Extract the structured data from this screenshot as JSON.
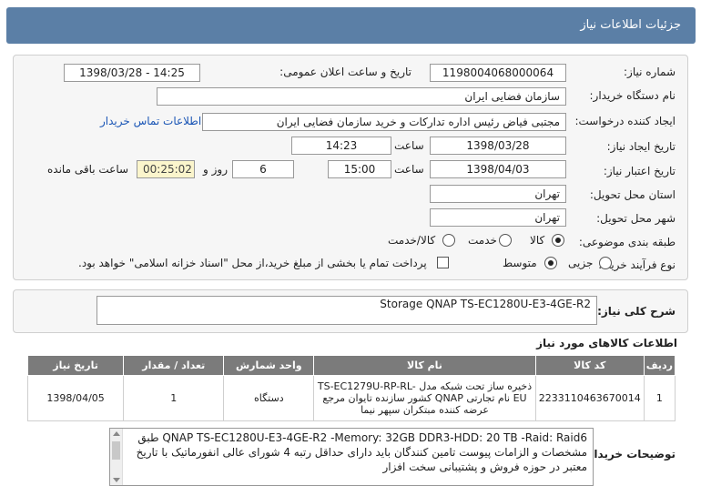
{
  "header": {
    "title": "جزئیات اطلاعات نیاز"
  },
  "form": {
    "need_number_label": "شماره نیاز:",
    "need_number": "1198004068000064",
    "announce_label": "تاریخ و ساعت اعلان عمومی:",
    "announce_value": "1398/03/28 - 14:25",
    "buyer_org_label": "نام دستگاه خریدار:",
    "buyer_org": "سازمان فضایی ایران",
    "creator_label": "ایجاد کننده درخواست:",
    "creator": "مجتبی  فیاض رئیس اداره تدارکات و خرید سازمان فضایی ایران",
    "contact_link": "اطلاعات تماس خریدار",
    "created_label": "تاریخ ایجاد نیاز:",
    "created_date": "1398/03/28",
    "time_label": "ساعت",
    "created_time": "14:23",
    "valid_label": "تاریخ اعتبار نیاز:",
    "valid_date": "1398/04/03",
    "valid_time": "15:00",
    "days_value": "6",
    "days_label": "روز و",
    "remaining_time": "00:25:02",
    "remaining_label": "ساعت باقی مانده",
    "province_label": "استان محل تحویل:",
    "province": "تهران",
    "city_label": "شهر محل تحویل:",
    "city": "تهران",
    "category_label": "طبقه بندی موضوعی:",
    "category_options": [
      "کالا",
      "خدمت",
      "کالا/خدمت"
    ],
    "process_label": "نوع فرآیند خرید :",
    "process_options": [
      "جزیی",
      "متوسط"
    ],
    "payment_note": "پرداخت تمام یا بخشی از مبلغ خرید،از محل \"اسناد خزانه اسلامی\" خواهد بود."
  },
  "summary": {
    "label": "شرح کلی نیاز:",
    "value": "Storage QNAP  TS-EC1280U-E3-4GE-R2"
  },
  "goods": {
    "title": "اطلاعات کالاهای مورد نیاز",
    "columns": [
      "ردیف",
      "کد کالا",
      "نام کالا",
      "واحد شمارش",
      "تعداد / مقدار",
      "تاریخ نیاز"
    ],
    "rows": [
      {
        "row": "1",
        "code": "2233110463670014",
        "name": "ذخیره ساز تحت شبکه مدل TS-EC1279U-RP-RL-EU نام تجارتی QNAP کشور سازنده تایوان مرجع عرضه کننده مبتکران سپهر نیما",
        "unit": "دستگاه",
        "qty": "1",
        "date": "1398/04/05"
      }
    ]
  },
  "buyer_notes": {
    "label": "توضیحات خریدار:",
    "text": "QNAP  TS-EC1280U-E3-4GE-R2 -Memory: 32GB DDR3-HDD: 20 TB -Raid: Raid6 طبق مشخصات و الزامات پیوست تامین کنندگان باید دارای حداقل رتبه 4 شورای عالی انفورماتیک با تاریخ معتبر در حوزه فروش و پشتیبانی سخت افزار"
  }
}
